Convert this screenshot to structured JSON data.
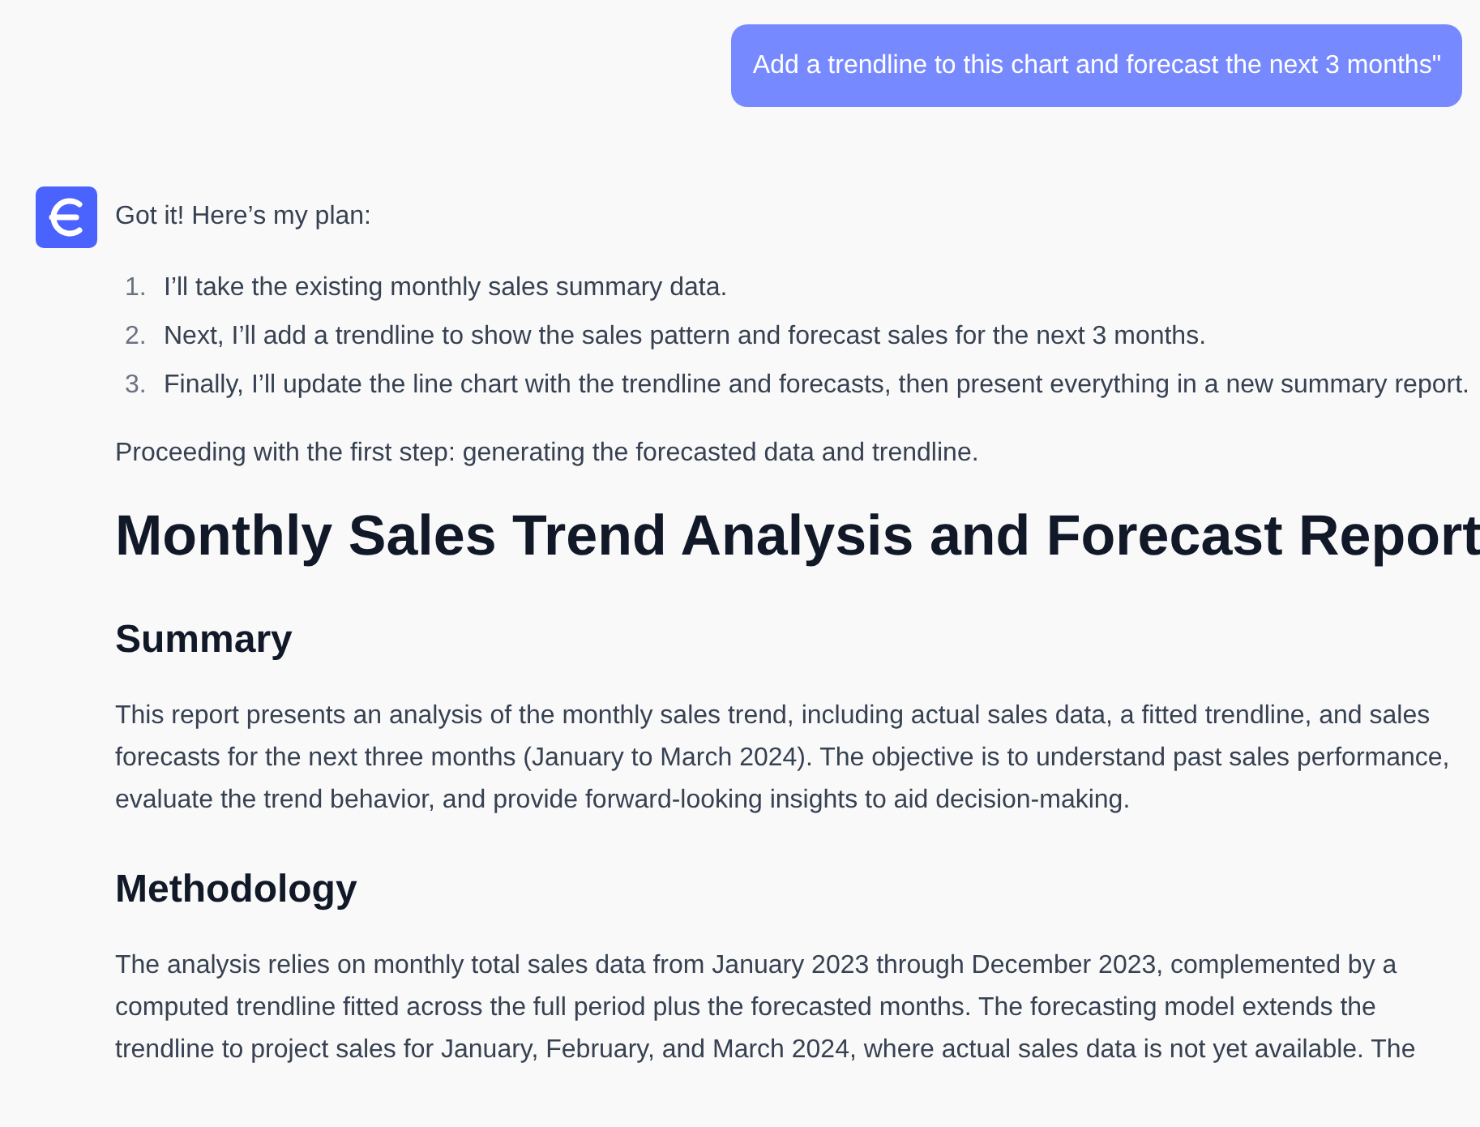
{
  "user_message": "Add a trendline to this chart and forecast the next 3 months\"",
  "assistant": {
    "intro": "Got it! Here’s my plan:",
    "plan": [
      {
        "number": "1.",
        "text": "I’ll take the existing monthly sales summary data."
      },
      {
        "number": "2.",
        "text": "Next, I’ll add a trendline to show the sales pattern and forecast sales for the next 3 months."
      },
      {
        "number": "3.",
        "text": "Finally, I’ll update the line chart with the trendline and forecasts, then present everything in a new summary report."
      }
    ],
    "status": "Proceeding with the first step: generating the forecasted data and trendline.",
    "report": {
      "title": "Monthly Sales Trend Analysis and Forecast Report",
      "sections": [
        {
          "heading": "Summary",
          "body": "This report presents an analysis of the monthly sales trend, including actual sales data, a fitted trendline, and sales forecasts for the next three months (January to March 2024). The objective is to understand past sales performance, evaluate the trend behavior, and provide forward-looking insights to aid decision-making."
        },
        {
          "heading": "Methodology",
          "body": "The analysis relies on monthly total sales data from January 2023 through December 2023, complemented by a computed trendline fitted across the full period plus the forecasted months. The forecasting model extends the trendline to project sales for January, February, and March 2024, where actual sales data is not yet available. The"
        }
      ]
    }
  }
}
